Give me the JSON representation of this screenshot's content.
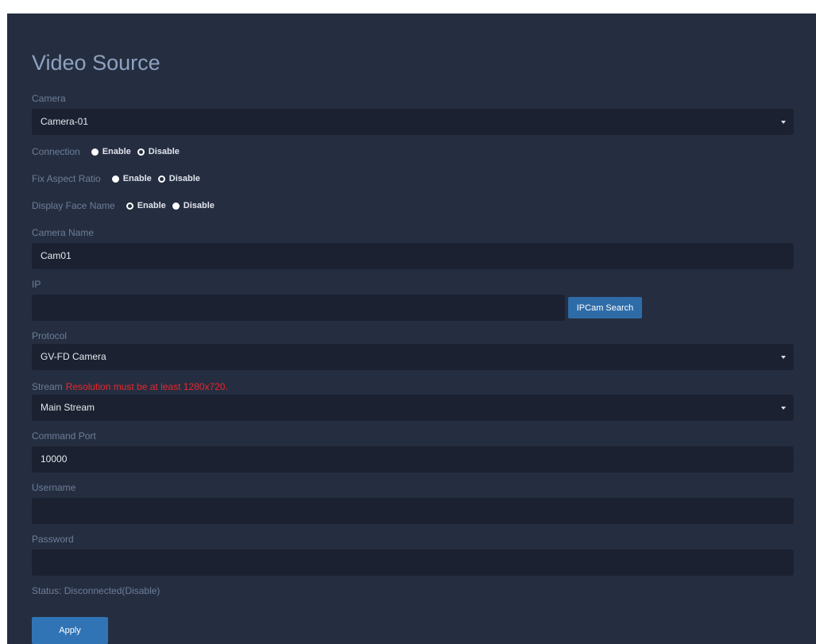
{
  "title": "Video Source",
  "camera": {
    "label": "Camera",
    "selected": "Camera-01"
  },
  "connection": {
    "label": "Connection",
    "options": [
      "Enable",
      "Disable"
    ],
    "selected": "Disable"
  },
  "fix_aspect_ratio": {
    "label": "Fix Aspect Ratio",
    "options": [
      "Enable",
      "Disable"
    ],
    "selected": "Disable"
  },
  "display_face_name": {
    "label": "Display Face Name",
    "options": [
      "Enable",
      "Disable"
    ],
    "selected": "Enable"
  },
  "camera_name": {
    "label": "Camera Name",
    "value": "Cam01"
  },
  "ip": {
    "label": "IP",
    "value": "",
    "search_button": "IPCam Search"
  },
  "protocol": {
    "label": "Protocol",
    "selected": "GV-FD Camera"
  },
  "stream": {
    "label": "Stream",
    "warning": "Resolution must be at least 1280x720.",
    "selected": "Main Stream"
  },
  "command_port": {
    "label": "Command Port",
    "value": "10000"
  },
  "username": {
    "label": "Username",
    "value": ""
  },
  "password": {
    "label": "Password",
    "value": ""
  },
  "status": "Status: Disconnected(Disable)",
  "apply_button": "Apply",
  "colors": {
    "panel_background": "#252e40",
    "field_background": "#1b2130",
    "label": "#6d7d98",
    "title": "#8fa1c0",
    "button": "#3174b5",
    "warning": "#e8262d"
  }
}
